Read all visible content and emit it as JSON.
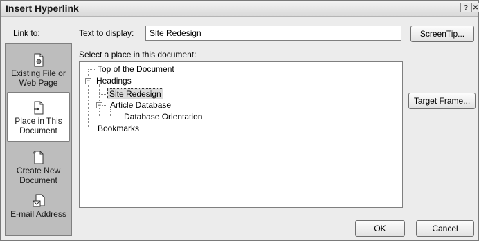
{
  "window": {
    "title": "Insert Hyperlink",
    "help_glyph": "?",
    "close_glyph": "✕"
  },
  "link_to": {
    "label": "Link to:",
    "items": [
      {
        "lines": [
          "Existing File or",
          "Web Page"
        ],
        "icon": "existing-file-icon",
        "selected": false
      },
      {
        "lines": [
          "Place in This",
          "Document"
        ],
        "icon": "place-in-document-icon",
        "selected": true
      },
      {
        "lines": [
          "Create New",
          "Document"
        ],
        "icon": "create-new-document-icon",
        "selected": false
      },
      {
        "lines": [
          "E-mail Address",
          ""
        ],
        "icon": "email-address-icon",
        "selected": false
      }
    ]
  },
  "text_to_display": {
    "label": "Text to display:",
    "value": "Site Redesign"
  },
  "screentip_label": "ScreenTip...",
  "place_label": "Select a place in this document:",
  "tree": {
    "top": "Top of the Document",
    "headings": "Headings",
    "site_redesign": "Site Redesign",
    "article_database": "Article Database",
    "database_orientation": "Database Orientation",
    "bookmarks": "Bookmarks",
    "collapse_glyph": "−"
  },
  "target_frame_label": "Target Frame...",
  "ok_label": "OK",
  "cancel_label": "Cancel",
  "colors": {
    "dialog_bg": "#ececec",
    "link_panel_bg": "#bdbdbd",
    "selected_bg": "#ffffff"
  }
}
